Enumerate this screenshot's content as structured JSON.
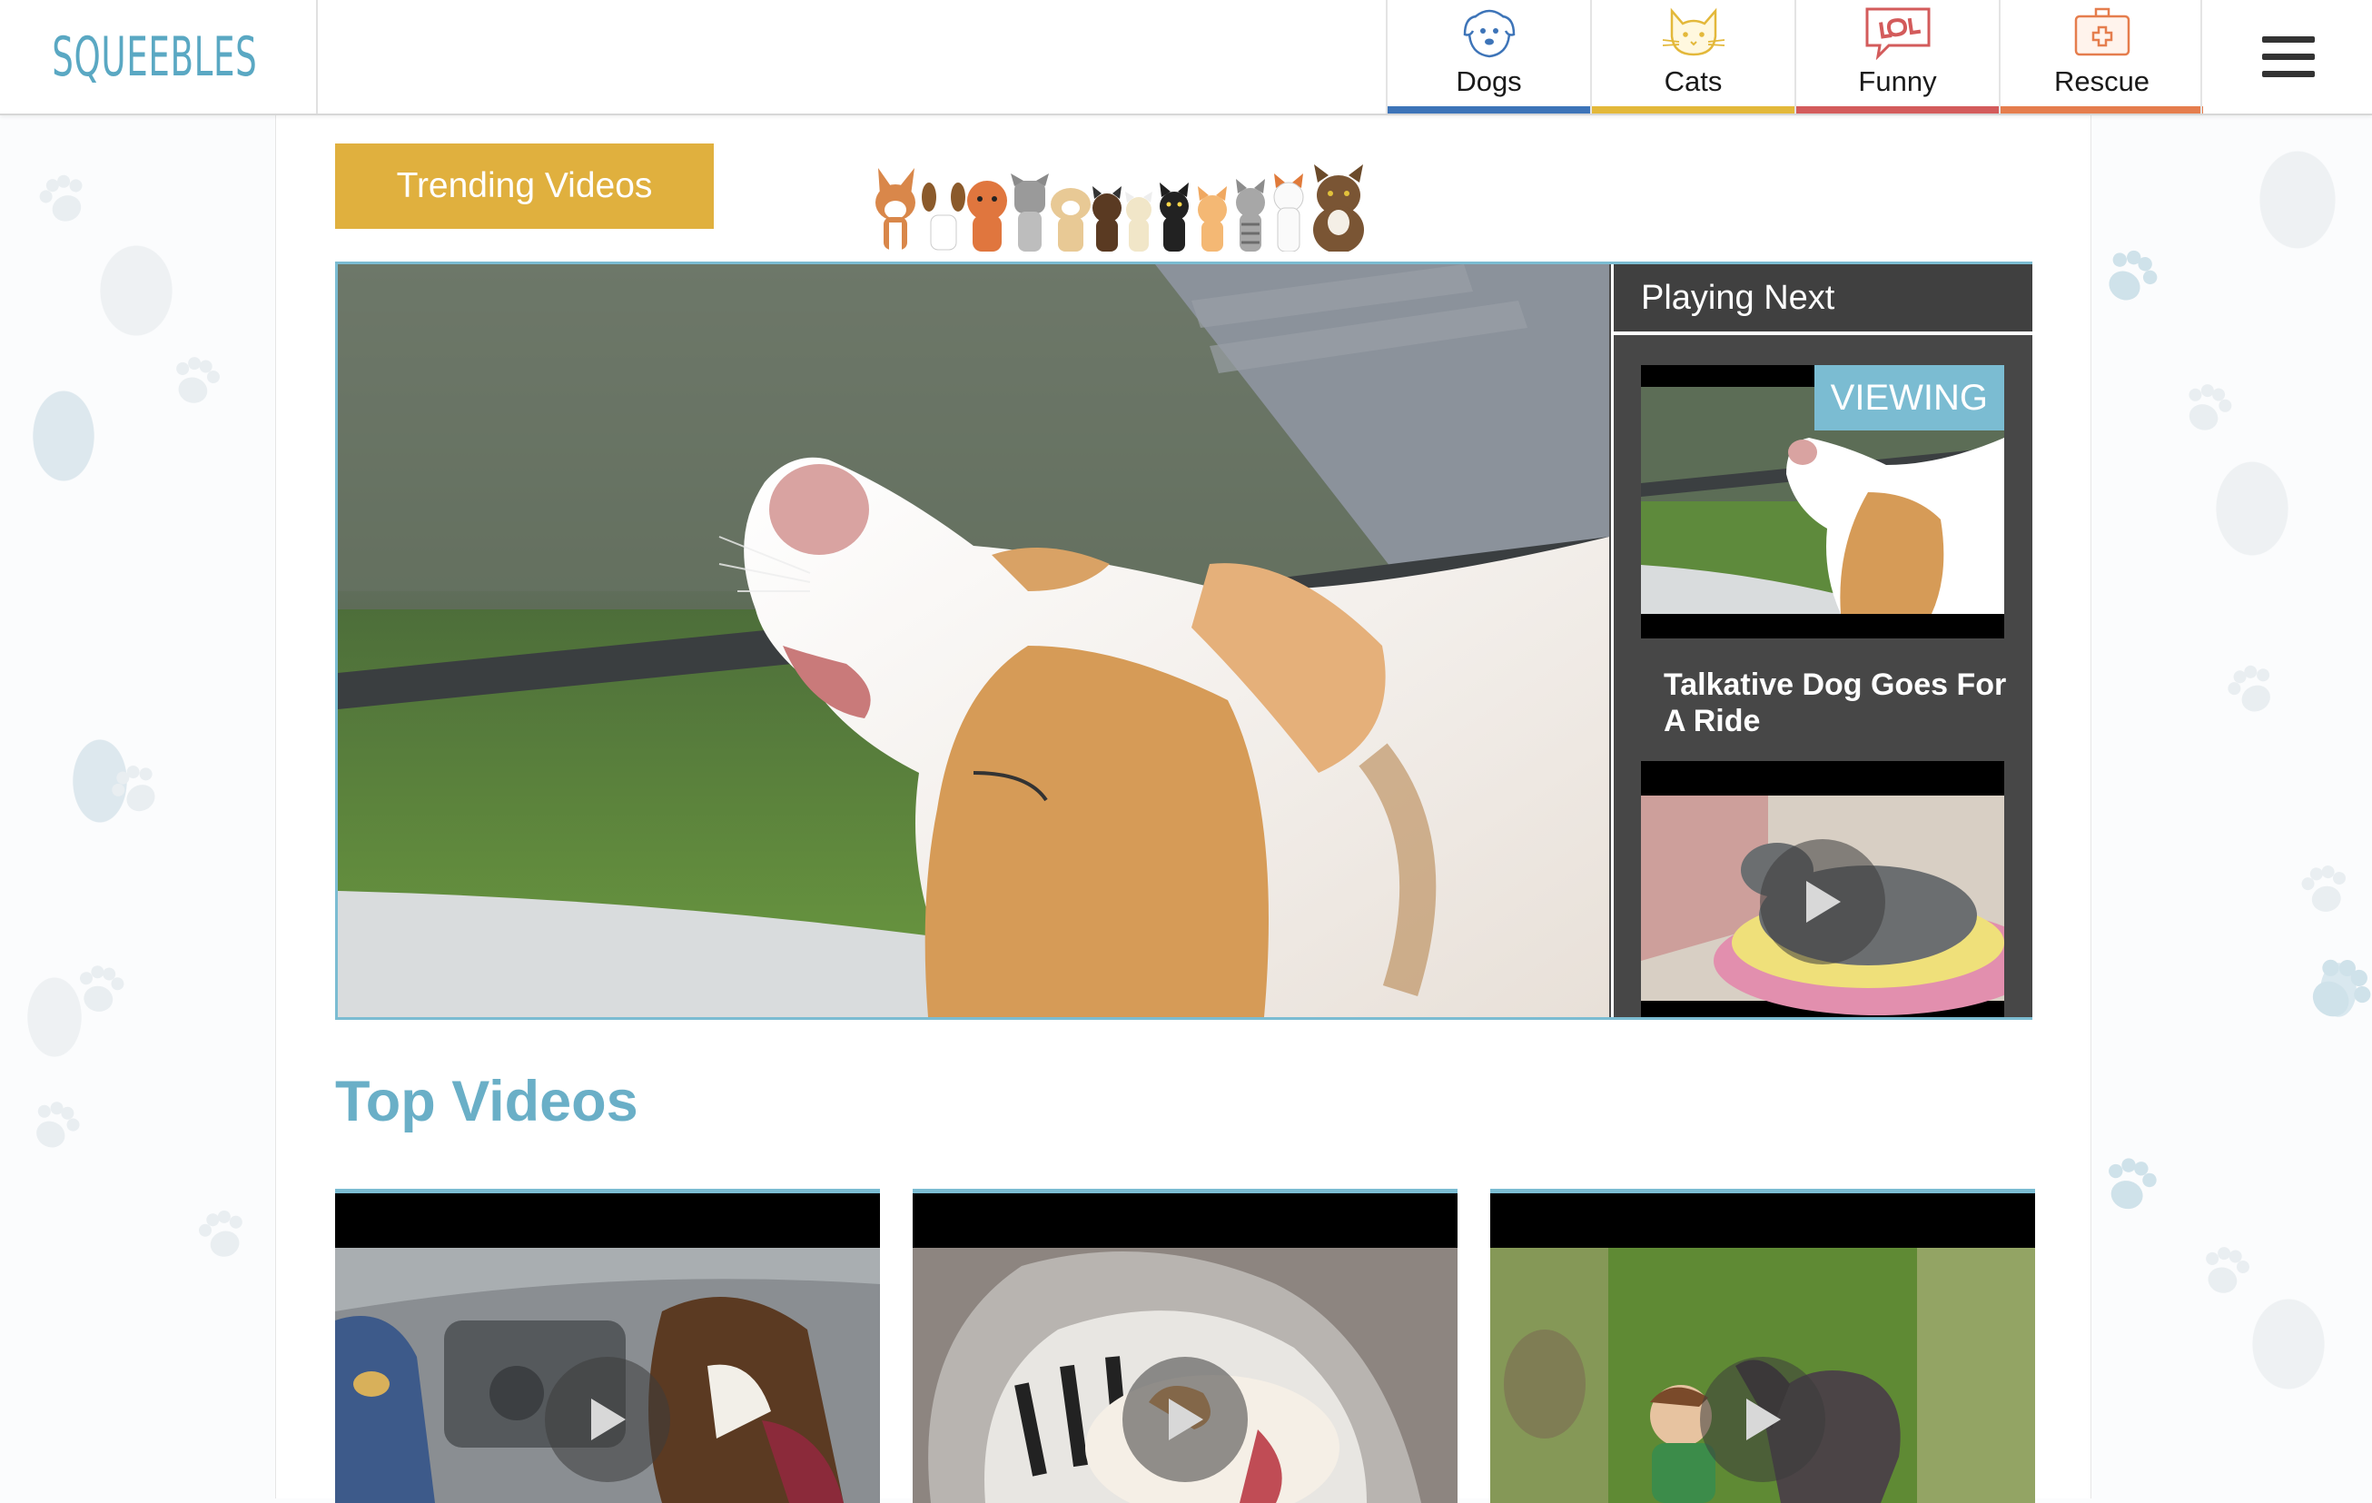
{
  "brand": {
    "logo_text": "SQUEEBLES",
    "accent": "#6aafc7",
    "gold": "#e0b03e"
  },
  "nav": {
    "items": [
      {
        "label": "Dogs",
        "icon": "dog-icon",
        "color": "#3d74b8"
      },
      {
        "label": "Cats",
        "icon": "cat-icon",
        "color": "#e3b83a"
      },
      {
        "label": "Funny",
        "icon": "lol-icon",
        "color": "#d35b5b"
      },
      {
        "label": "Rescue",
        "icon": "first-aid-kit-icon",
        "color": "#e57d4d"
      }
    ],
    "menu_icon": "hamburger-menu-icon"
  },
  "trending": {
    "button_label": "Trending Videos"
  },
  "player": {
    "playing_next_label": "Playing Next",
    "viewing_badge": "VIEWING",
    "next_items": [
      {
        "title": "Talkative Dog Goes For A Ride",
        "status": "viewing"
      },
      {
        "title": "",
        "status": "up-next"
      }
    ]
  },
  "top_videos": {
    "heading": "Top Videos",
    "cards": [
      {
        "subject": "bulldog in car"
      },
      {
        "subject": "cat in shark costume"
      },
      {
        "subject": "child with pony"
      }
    ]
  }
}
